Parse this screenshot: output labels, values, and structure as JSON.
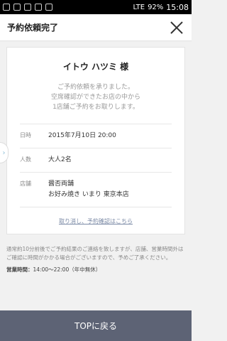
{
  "status_bar": {
    "battery": "92%",
    "time": "15:08",
    "network": "LTE"
  },
  "header": {
    "title": "予約依頼完了"
  },
  "card": {
    "guest_name": "イトウ ハツミ 様",
    "message": [
      "ご予約依頼を承りました。",
      "空席確認ができたお店の中から",
      "1店舗ご予約をお取りします。"
    ],
    "rows": [
      {
        "label": "日時",
        "value": "2015年7月10日 20:00"
      },
      {
        "label": "人数",
        "value": "大人2名"
      },
      {
        "label": "店舗",
        "value_lines": [
          "醤否両舗",
          "お好み焼き いまり 東京本店"
        ]
      }
    ],
    "link_text": "取り消し、予約確認はこちら"
  },
  "notes": {
    "text": "通常約10分前後でご予約結果のご連絡を致しますが、店舗、営業時間外はご確認に時間がかかる場合がございますので、予めご了承ください。",
    "hours_label": "営業時間：",
    "hours_value": "14:00〜22:00（年中無休）"
  },
  "bottom_button": {
    "label": "TOPに戻る"
  },
  "colors": {
    "bottom_button_bg": "#5d6375",
    "link": "#7b8aa6"
  }
}
